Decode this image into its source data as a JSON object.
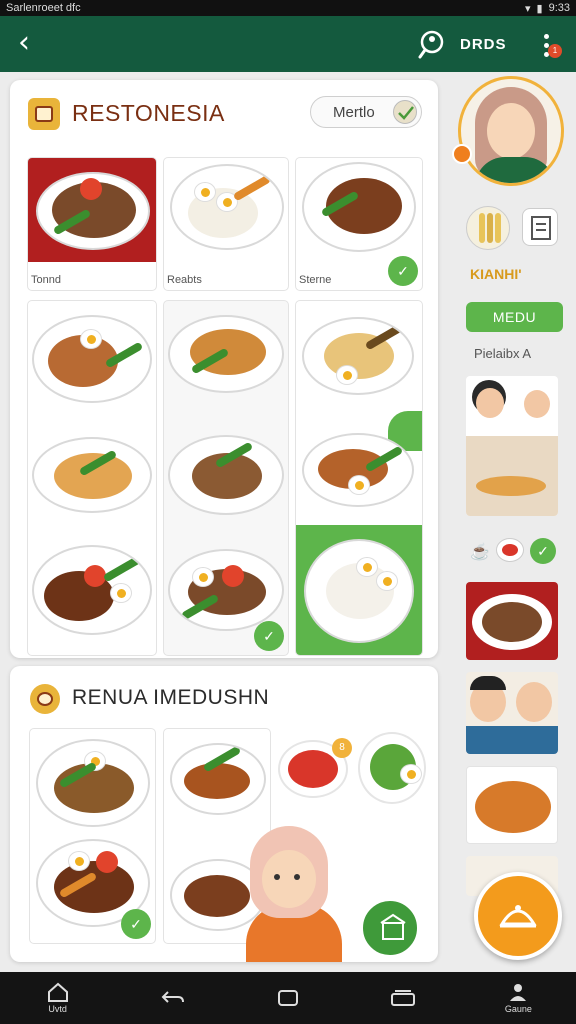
{
  "status_bar": {
    "left_text": "Sarlenroeet dfc",
    "time": "9:33"
  },
  "topbar": {
    "title": "DRDS",
    "badge": "1"
  },
  "card1": {
    "title": "RESTONESIA",
    "menu_label": "Mertlo",
    "tiles": [
      {
        "label": "Tonnd"
      },
      {
        "label": "Reabts"
      },
      {
        "label": "Sterne"
      }
    ]
  },
  "card2": {
    "title": "RENUA IMEDUSHN",
    "chip": "8"
  },
  "sidebar": {
    "label": "KIANHI'",
    "button": "MEDU",
    "sub_label": "Pielaibx A"
  },
  "navbar": {
    "home_label": "Uvtd",
    "profile_label": "Gaune"
  },
  "colors": {
    "brand": "#145a3e",
    "accent": "#5db54b",
    "orange": "#f39b1c",
    "title": "#7a2f12"
  }
}
